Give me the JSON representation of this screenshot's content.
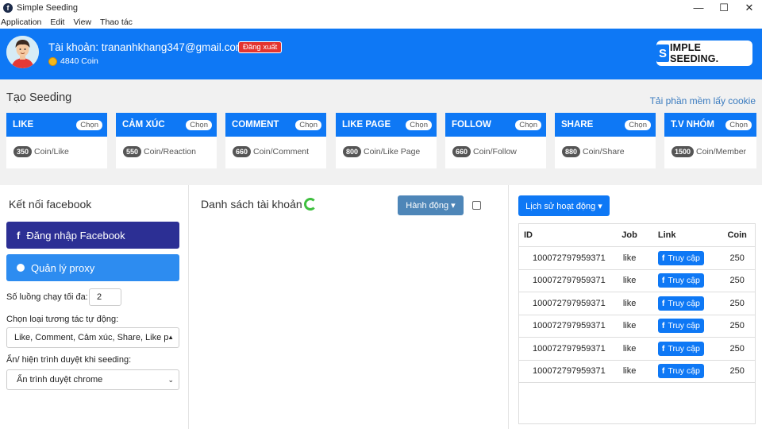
{
  "window": {
    "title": "Simple Seeding",
    "icon_letter": "f",
    "controls": [
      "—",
      "☐",
      "✕"
    ]
  },
  "menu": [
    "Application",
    "Edit",
    "View",
    "Thao tác"
  ],
  "header": {
    "account_label": "Tài khoản: trananhkhang347@gmail.com",
    "logout_label": "Đăng xuất",
    "coin_text": "4840 Coin",
    "brand_letter": "S",
    "brand_text": "IMPLE SEEDING."
  },
  "seeding": {
    "title": "Tạo Seeding",
    "tool_link": "Tải phần mềm lấy cookie",
    "choose_label": "Chọn",
    "cards": [
      {
        "name": "LIKE",
        "cost": "350",
        "unit": "Coin/Like"
      },
      {
        "name": "CẢM XÚC",
        "cost": "550",
        "unit": "Coin/Reaction"
      },
      {
        "name": "COMMENT",
        "cost": "660",
        "unit": "Coin/Comment"
      },
      {
        "name": "LIKE PAGE",
        "cost": "800",
        "unit": "Coin/Like Page"
      },
      {
        "name": "FOLLOW",
        "cost": "660",
        "unit": "Coin/Follow"
      },
      {
        "name": "SHARE",
        "cost": "880",
        "unit": "Coin/Share"
      },
      {
        "name": "T.V NHÓM",
        "cost": "1500",
        "unit": "Coin/Member"
      }
    ]
  },
  "connect": {
    "title": "Kết nối facebook",
    "login_fb_icon": "f",
    "login_fb_label": "Đăng nhập Facebook",
    "proxy_label": "Quản lý proxy",
    "threads_label": "Số luồng chạy tối đa:",
    "threads_value": "2",
    "auto_label": "Chọn loại tương tác tự động:",
    "auto_value": "Like, Comment, Cảm xúc, Share, Like p",
    "browser_label": "Ẩn/ hiện trình duyệt khi seeding:",
    "browser_value": "Ẩn trình duyệt chrome"
  },
  "accounts": {
    "title": "Danh sách tài khoản",
    "action_label": "Hành động ▾"
  },
  "history": {
    "button_label": "Lịch sử hoạt động ▾",
    "columns": [
      "ID",
      "Job",
      "Link",
      "Coin"
    ],
    "visit_icon": "f",
    "visit_label": "Truy cập",
    "rows": [
      {
        "id": "100072797959371",
        "job": "like",
        "coin": "250"
      },
      {
        "id": "100072797959371",
        "job": "like",
        "coin": "250"
      },
      {
        "id": "100072797959371",
        "job": "like",
        "coin": "250"
      },
      {
        "id": "100072797959371",
        "job": "like",
        "coin": "250"
      },
      {
        "id": "100072797959371",
        "job": "like",
        "coin": "250"
      },
      {
        "id": "100072797959371",
        "job": "like",
        "coin": "250"
      }
    ]
  }
}
